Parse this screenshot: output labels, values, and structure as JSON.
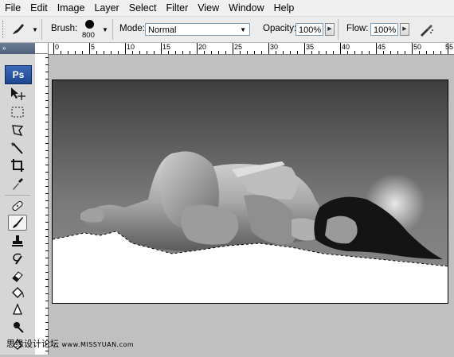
{
  "menu": [
    "File",
    "Edit",
    "Image",
    "Layer",
    "Select",
    "Filter",
    "View",
    "Window",
    "Help"
  ],
  "options": {
    "brush_label": "Brush:",
    "brush_size": "800",
    "mode_label": "Mode:",
    "mode_value": "Normal",
    "opacity_label": "Opacity:",
    "opacity_value": "100%",
    "flow_label": "Flow:",
    "flow_value": "100%"
  },
  "toolbox": {
    "collapse": "»",
    "logo": "Ps",
    "active_tool": "brush-tool"
  },
  "ruler": {
    "labels": [
      "0",
      "5",
      "10",
      "15",
      "20",
      "25",
      "30",
      "35",
      "40",
      "45",
      "50",
      "55"
    ]
  },
  "watermark": {
    "cn": "思缘设计论坛",
    "url": "www.MISSYUAN.com"
  }
}
